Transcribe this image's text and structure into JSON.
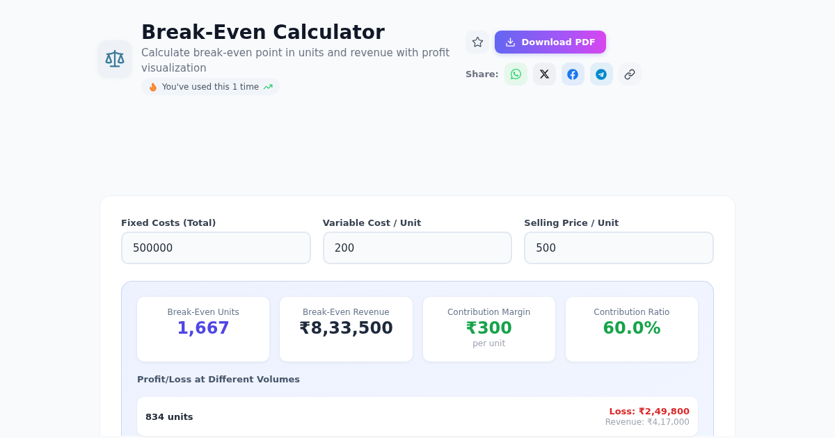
{
  "header": {
    "title": "Break-Even Calculator",
    "subtitle": "Calculate break-even point in units and revenue with profit visualization",
    "usage_badge": "You've used this 1 time"
  },
  "actions": {
    "favorited": false,
    "download_button": "Download PDF",
    "share_label": "Share:",
    "share_buttons": [
      {
        "kind": "whatsapp"
      },
      {
        "kind": "x"
      },
      {
        "kind": "facebook"
      },
      {
        "kind": "telegram"
      },
      {
        "kind": "link"
      }
    ]
  },
  "inputs": [
    {
      "label": "Fixed Costs (Total)",
      "value": "500000"
    },
    {
      "label": "Variable Cost / Unit",
      "value": "200"
    },
    {
      "label": "Selling Price / Unit",
      "value": "500"
    }
  ],
  "stats": [
    {
      "label": "Break-Even Units",
      "value": "1,667",
      "color": "#4f46e5"
    },
    {
      "label": "Break-Even Revenue",
      "value": "₹8,33,500",
      "color": "#1e293b"
    },
    {
      "label": "Contribution Margin",
      "value": "₹300",
      "note": "per unit",
      "color": "#16a34a"
    },
    {
      "label": "Contribution Ratio",
      "value": "60.0%",
      "color": "#16a34a"
    }
  ],
  "volumes": {
    "title": "Profit/Loss at Different Volumes",
    "rows": [
      {
        "kind": "loss",
        "units": "834 units",
        "result": "Loss: ₹2,49,800",
        "revenue": "Revenue: ₹4,17,000"
      }
    ]
  }
}
